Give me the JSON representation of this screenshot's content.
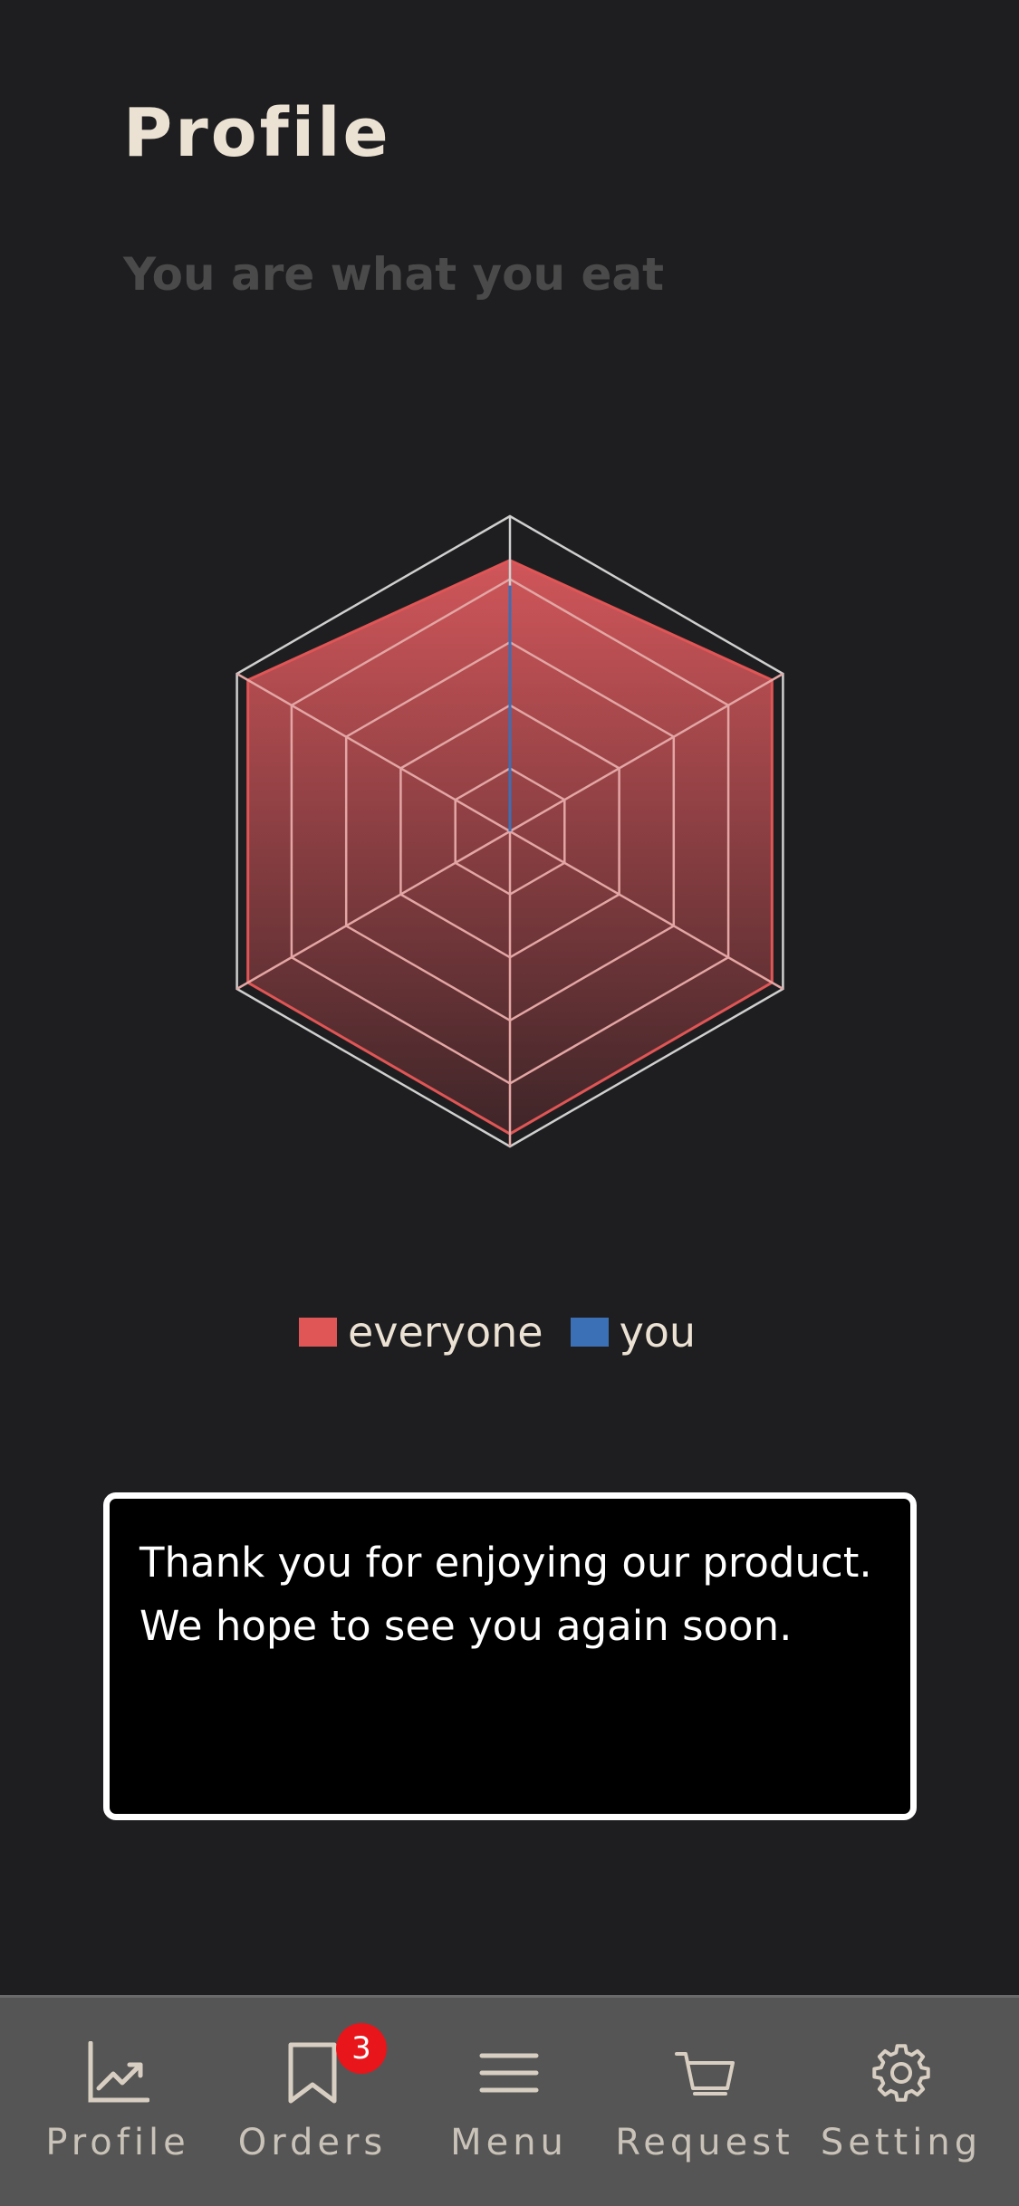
{
  "header": {
    "title": "Profile",
    "subtitle": "You are what you eat"
  },
  "chart_data": {
    "type": "radar",
    "axes": 6,
    "levels": 4,
    "max": 1.0,
    "series": [
      {
        "name": "everyone",
        "color": "#e05555",
        "values": [
          0.86,
          0.96,
          0.96,
          0.96,
          0.96,
          0.96
        ]
      },
      {
        "name": "you",
        "color": "#3b6fb6",
        "values": [
          0.78,
          0,
          0,
          0,
          0,
          0
        ]
      }
    ]
  },
  "legend": [
    {
      "label": "everyone",
      "color": "#e05555"
    },
    {
      "label": "you",
      "color": "#3b6fb6"
    }
  ],
  "message": {
    "text": "Thank you for enjoying our product. We hope to see you again soon."
  },
  "tabbar": {
    "items": [
      {
        "label": "Profile",
        "icon": "chart-line-icon"
      },
      {
        "label": "Orders",
        "icon": "bookmark-icon",
        "badge": "3"
      },
      {
        "label": "Menu",
        "icon": "menu-icon"
      },
      {
        "label": "Request",
        "icon": "cart-icon"
      },
      {
        "label": "Setting",
        "icon": "gear-icon"
      }
    ]
  }
}
